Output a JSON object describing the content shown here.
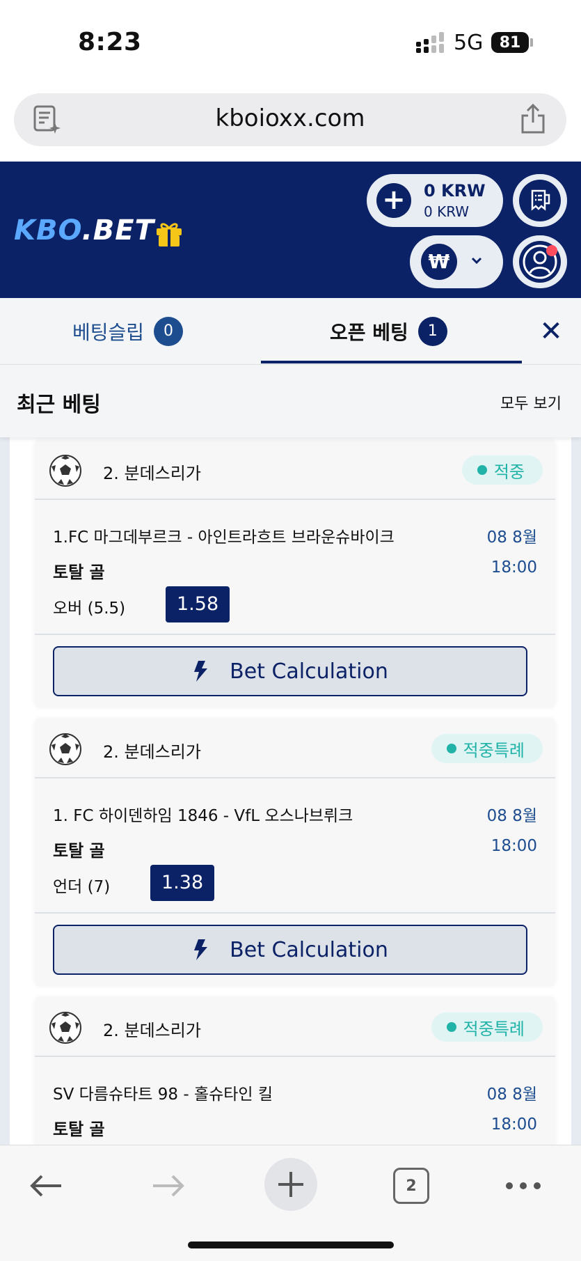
{
  "status_bar": {
    "time": "8:23",
    "network": "5G",
    "battery": "81"
  },
  "browser": {
    "url": "kboioxx.com"
  },
  "header": {
    "logo_part1": "KBO",
    "logo_part2": ".BET",
    "balance_main": "0 KRW",
    "balance_sub": "0 KRW",
    "currency_symbol": "₩",
    "brand_color": "#0b2266",
    "accent_color": "#5aa9ff"
  },
  "tabs": [
    {
      "label": "베팅슬립",
      "count": "0"
    },
    {
      "label": "오픈 베팅",
      "count": "1"
    }
  ],
  "recent": {
    "title": "최근 베팅",
    "see_all": "모두 보기"
  },
  "bets": [
    {
      "league": "2. 분데스리가",
      "status": "적중",
      "match": "1.FC 마그데부르크 - 아인트라흐트 브라운슈바이크",
      "date": "08 8월",
      "market": "토탈 골",
      "time": "18:00",
      "selection": "오버 (5.5)",
      "odds": "1.58",
      "button": "Bet Calculation"
    },
    {
      "league": "2. 분데스리가",
      "status": "적중특례",
      "match": "1. FC 하이덴하임 1846 - VfL 오스나브뤼크",
      "date": "08 8월",
      "market": "토탈 골",
      "time": "18:00",
      "selection": "언더 (7)",
      "odds": "1.38",
      "button": "Bet Calculation"
    },
    {
      "league": "2. 분데스리가",
      "status": "적중특례",
      "match": "SV 다름슈타트 98 - 홀슈타인 킬",
      "date": "08 8월",
      "market": "토탈 골",
      "time": "18:00"
    }
  ],
  "toolbar": {
    "tab_count": "2"
  }
}
